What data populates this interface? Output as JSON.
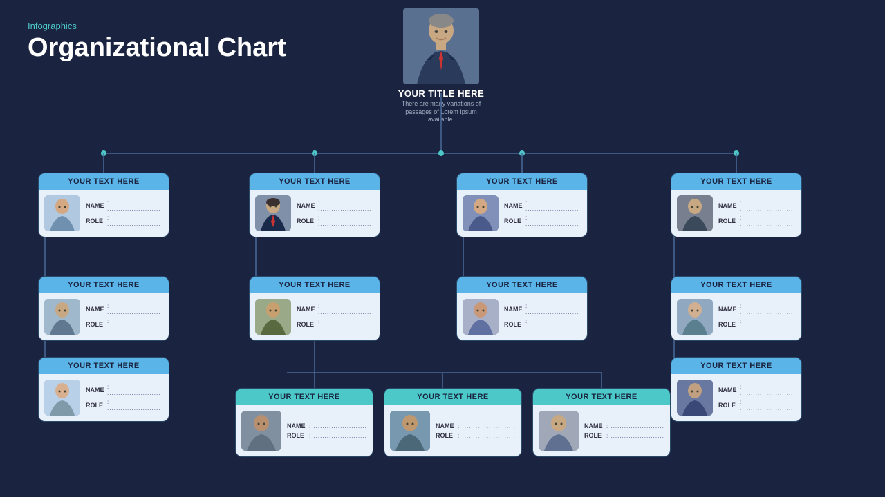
{
  "header": {
    "infographics": "Infographics",
    "title": "Organizational Chart"
  },
  "root": {
    "title": "YOUR TITLE HERE",
    "description": "There are many variations of passages of Lorem Ipsum available."
  },
  "cards": {
    "c1r1": {
      "header": "YOUR TEXT HERE",
      "name_label": "NAME",
      "role_label": "ROLE",
      "dots": "........................"
    },
    "c1r2": {
      "header": "YOUR TEXT HERE",
      "name_label": "NAME",
      "role_label": "ROLE",
      "dots": "........................"
    },
    "c1r3": {
      "header": "YOUR TEXT HERE",
      "name_label": "NAME",
      "role_label": "ROLE",
      "dots": "........................"
    },
    "c2r1": {
      "header": "YOUR TEXT HERE",
      "name_label": "NAME",
      "role_label": "ROLE",
      "dots": "........................"
    },
    "c2r2": {
      "header": "YOUR TEXT HERE",
      "name_label": "NAME",
      "role_label": "ROLE",
      "dots": "........................"
    },
    "c3r1": {
      "header": "YOUR TEXT HERE",
      "name_label": "NAME",
      "role_label": "ROLE",
      "dots": "........................"
    },
    "c3r2": {
      "header": "YOUR TEXT HERE",
      "name_label": "NAME",
      "role_label": "ROLE",
      "dots": "........................"
    },
    "c4r1": {
      "header": "YOUR TEXT HERE",
      "name_label": "NAME",
      "role_label": "ROLE",
      "dots": "........................"
    },
    "c4r2": {
      "header": "YOUR TEXT HERE",
      "name_label": "NAME",
      "role_label": "ROLE",
      "dots": "........................"
    },
    "c4r3": {
      "header": "YOUR TEXT HERE",
      "name_label": "NAME",
      "role_label": "ROLE",
      "dots": "........................"
    },
    "b1": {
      "header": "YOUR TEXT HERE",
      "name_label": "NAME",
      "role_label": "ROLE",
      "dots": "........................"
    },
    "b2": {
      "header": "YOUR TEXT HERE",
      "name_label": "NAME",
      "role_label": "ROLE",
      "dots": "........................"
    },
    "b3": {
      "header": "YOUR TEXT HERE",
      "name_label": "NAME",
      "role_label": "ROLE",
      "dots": "........................"
    }
  },
  "colors": {
    "blue_header": "#5ab4e8",
    "teal_header": "#4dc8c8",
    "bg_dark": "#1a2340",
    "connector": "#4a6a9a"
  }
}
